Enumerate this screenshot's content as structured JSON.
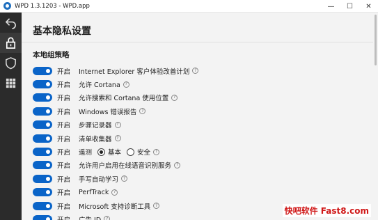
{
  "window": {
    "title": "WPD 1.3.1203 - WPD.app",
    "minimize_glyph": "—",
    "maximize_glyph": "☐",
    "close_glyph": "✕"
  },
  "sidebar": {
    "items": [
      {
        "icon": "back-arrow-icon"
      },
      {
        "icon": "lock-icon"
      },
      {
        "icon": "shield-icon"
      },
      {
        "icon": "apps-grid-icon"
      }
    ]
  },
  "main": {
    "page_title": "基本隐私设置",
    "section_title": "本地组策略",
    "help_glyph": "?",
    "rows": [
      {
        "state": "开启",
        "label": "Internet Explorer 客户体验改善计划"
      },
      {
        "state": "开启",
        "label": "允许 Cortana"
      },
      {
        "state": "开启",
        "label": "允许搜索和 Cortana 使用位置"
      },
      {
        "state": "开启",
        "label": "Windows 错误报告"
      },
      {
        "state": "开启",
        "label": "步骤记录器"
      },
      {
        "state": "开启",
        "label": "清单收集器"
      },
      {
        "state": "开启",
        "label": "遥测",
        "options": [
          "基本",
          "安全"
        ],
        "selected": "基本"
      },
      {
        "state": "开启",
        "label": "允许用户启用在线语音识别服务"
      },
      {
        "state": "开启",
        "label": "手写自动学习"
      },
      {
        "state": "开启",
        "label": "PerfTrack"
      },
      {
        "state": "开启",
        "label": "Microsoft 支持诊断工具"
      },
      {
        "state": "开启",
        "label": "广告 ID"
      }
    ]
  },
  "watermark": "快吧软件 Fast8.com",
  "colors": {
    "toggle_on": "#0a64c8",
    "sidebar_bg": "#2b2b2b",
    "watermark": "#d01818"
  }
}
